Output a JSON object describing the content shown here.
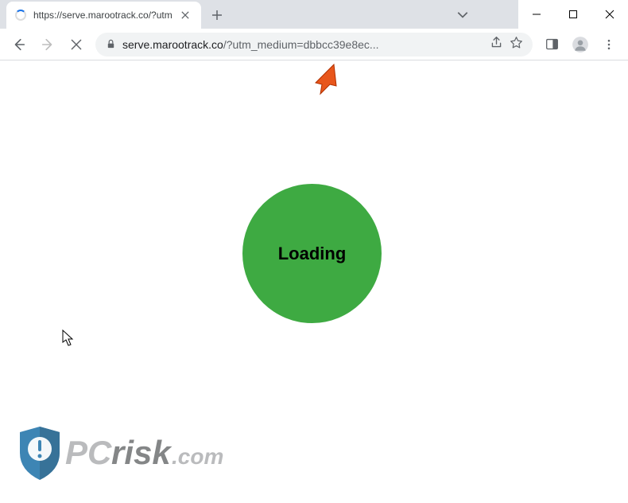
{
  "window": {
    "chevron_icon": "⌄",
    "minimize_icon": "—",
    "maximize_icon": "□",
    "close_icon": "✕"
  },
  "tab": {
    "title": "https://serve.marootrack.co/?utm",
    "close_icon": "✕"
  },
  "newtab": {
    "plus": "+"
  },
  "toolbar": {
    "url_domain": "serve.marootrack.co",
    "url_path": "/?utm_medium=dbbcc39e8ec..."
  },
  "content": {
    "loading_label": "Loading"
  },
  "watermark": {
    "brand_prefix": "PC",
    "brand_suffix": "risk",
    "brand_tld": ".com"
  }
}
